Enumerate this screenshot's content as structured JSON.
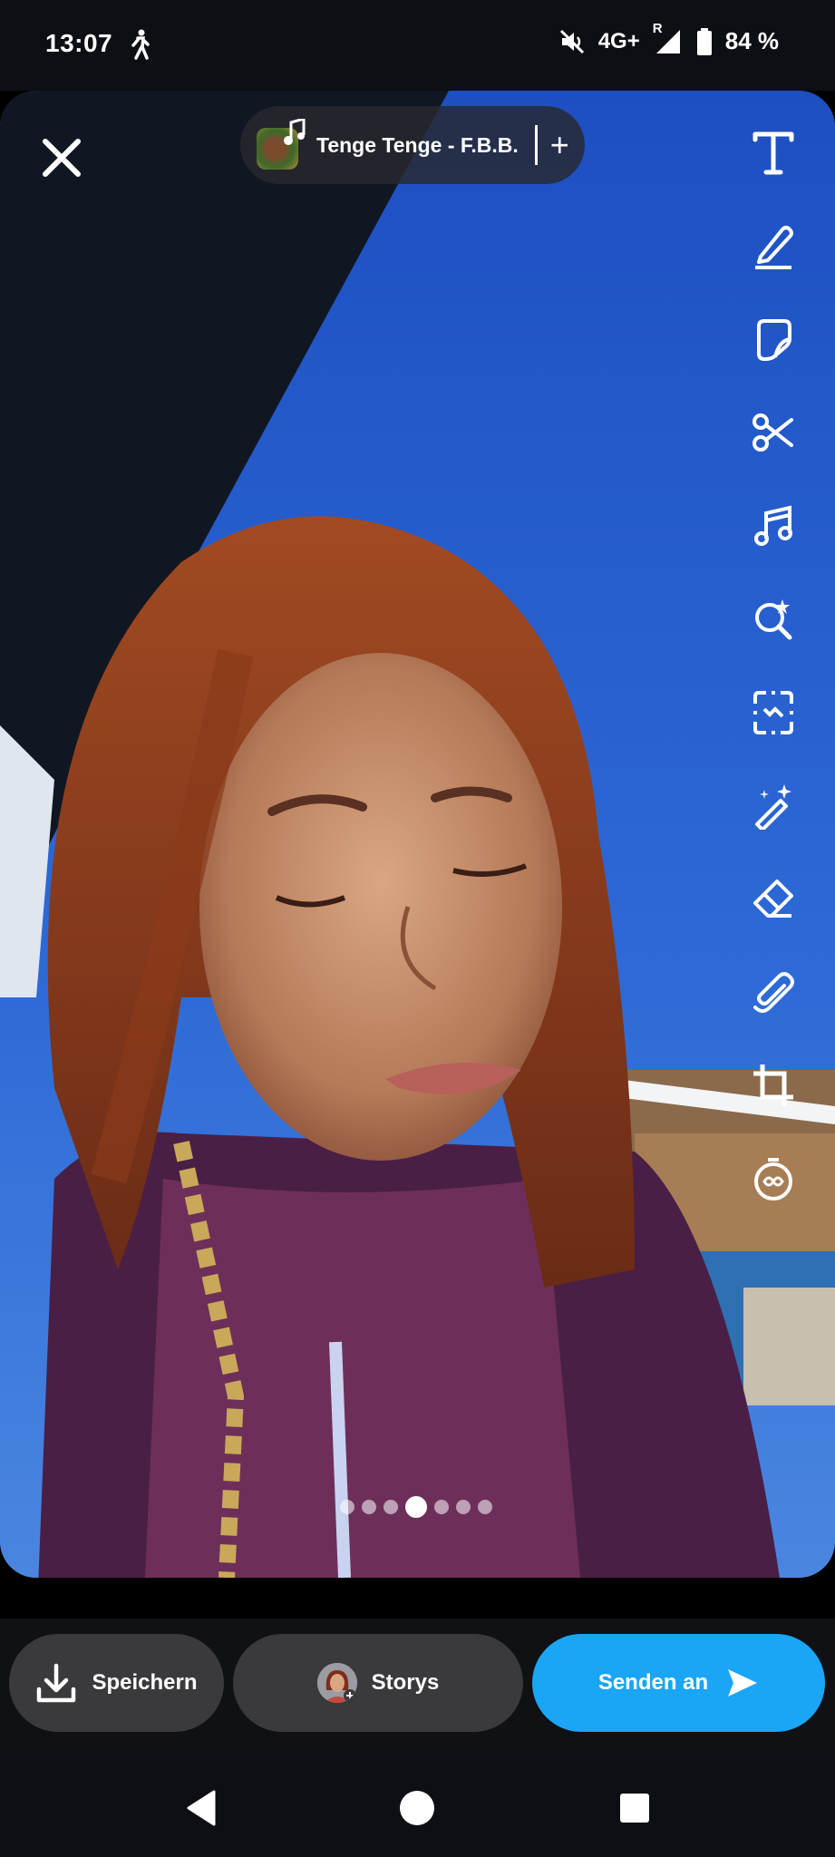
{
  "status_bar": {
    "time": "13:07",
    "network": "4G+",
    "roaming": "R",
    "battery": "84 %",
    "icons": [
      "walking-icon",
      "mute-icon",
      "signal-icon",
      "battery-icon"
    ]
  },
  "editor": {
    "music": {
      "track": "Tenge Tenge - F.B.B.",
      "add": "+"
    },
    "tools": [
      "text-tool-icon",
      "pencil-icon",
      "sticker-icon",
      "scissors-icon",
      "music-note-icon",
      "lens-search-icon",
      "scan-icon",
      "magic-wand-icon",
      "eraser-icon",
      "paperclip-icon",
      "crop-icon",
      "timer-icon"
    ],
    "page_dots": {
      "count": 7,
      "active": 3
    }
  },
  "actions": {
    "save_label": "Speichern",
    "stories_label": "Storys",
    "send_label": "Senden an"
  },
  "colors": {
    "send_button": "#1aa6f5",
    "pill_bg": "#3a3a3d",
    "sky": "#2a62cf"
  }
}
